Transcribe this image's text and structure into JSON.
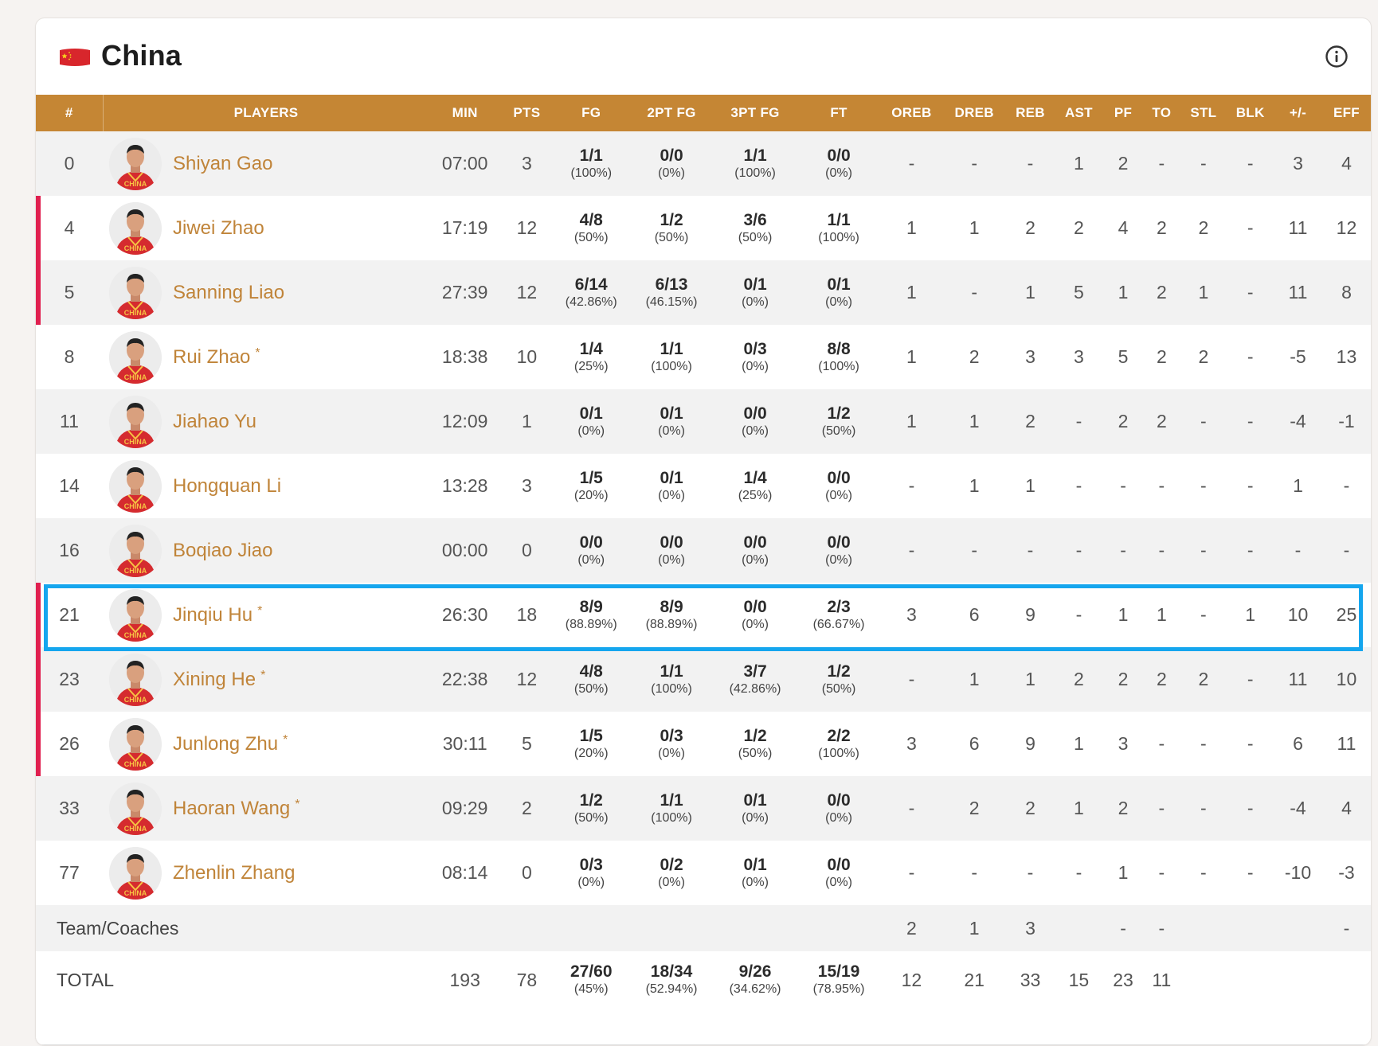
{
  "team": {
    "name": "China",
    "flag_icon": "china-flag-icon",
    "info_icon": "info-icon"
  },
  "columns": [
    "#",
    "PLAYERS",
    "MIN",
    "PTS",
    "FG",
    "2PT FG",
    "3PT FG",
    "FT",
    "OREB",
    "DREB",
    "REB",
    "AST",
    "PF",
    "TO",
    "STL",
    "BLK",
    "+/-",
    "EFF"
  ],
  "players": [
    {
      "num": "0",
      "name": "Shiyan Gao",
      "starter": false,
      "marked": false,
      "min": "07:00",
      "pts": "3",
      "fg": "1/1",
      "fg_pct": "(100%)",
      "fg2": "0/0",
      "fg2_pct": "(0%)",
      "fg3": "1/1",
      "fg3_pct": "(100%)",
      "ft": "0/0",
      "ft_pct": "(0%)",
      "oreb": "-",
      "dreb": "-",
      "reb": "-",
      "ast": "1",
      "pf": "2",
      "to": "-",
      "stl": "-",
      "blk": "-",
      "pm": "3",
      "eff": "4"
    },
    {
      "num": "4",
      "name": "Jiwei Zhao",
      "starter": false,
      "marked": true,
      "min": "17:19",
      "pts": "12",
      "fg": "4/8",
      "fg_pct": "(50%)",
      "fg2": "1/2",
      "fg2_pct": "(50%)",
      "fg3": "3/6",
      "fg3_pct": "(50%)",
      "ft": "1/1",
      "ft_pct": "(100%)",
      "oreb": "1",
      "dreb": "1",
      "reb": "2",
      "ast": "2",
      "pf": "4",
      "to": "2",
      "stl": "2",
      "blk": "-",
      "pm": "11",
      "eff": "12"
    },
    {
      "num": "5",
      "name": "Sanning Liao",
      "starter": false,
      "marked": true,
      "min": "27:39",
      "pts": "12",
      "fg": "6/14",
      "fg_pct": "(42.86%)",
      "fg2": "6/13",
      "fg2_pct": "(46.15%)",
      "fg3": "0/1",
      "fg3_pct": "(0%)",
      "ft": "0/1",
      "ft_pct": "(0%)",
      "oreb": "1",
      "dreb": "-",
      "reb": "1",
      "ast": "5",
      "pf": "1",
      "to": "2",
      "stl": "1",
      "blk": "-",
      "pm": "11",
      "eff": "8"
    },
    {
      "num": "8",
      "name": "Rui Zhao",
      "starter": true,
      "marked": false,
      "min": "18:38",
      "pts": "10",
      "fg": "1/4",
      "fg_pct": "(25%)",
      "fg2": "1/1",
      "fg2_pct": "(100%)",
      "fg3": "0/3",
      "fg3_pct": "(0%)",
      "ft": "8/8",
      "ft_pct": "(100%)",
      "oreb": "1",
      "dreb": "2",
      "reb": "3",
      "ast": "3",
      "pf": "5",
      "to": "2",
      "stl": "2",
      "blk": "-",
      "pm": "-5",
      "eff": "13"
    },
    {
      "num": "11",
      "name": "Jiahao Yu",
      "starter": false,
      "marked": false,
      "min": "12:09",
      "pts": "1",
      "fg": "0/1",
      "fg_pct": "(0%)",
      "fg2": "0/1",
      "fg2_pct": "(0%)",
      "fg3": "0/0",
      "fg3_pct": "(0%)",
      "ft": "1/2",
      "ft_pct": "(50%)",
      "oreb": "1",
      "dreb": "1",
      "reb": "2",
      "ast": "-",
      "pf": "2",
      "to": "2",
      "stl": "-",
      "blk": "-",
      "pm": "-4",
      "eff": "-1"
    },
    {
      "num": "14",
      "name": "Hongquan Li",
      "starter": false,
      "marked": false,
      "min": "13:28",
      "pts": "3",
      "fg": "1/5",
      "fg_pct": "(20%)",
      "fg2": "0/1",
      "fg2_pct": "(0%)",
      "fg3": "1/4",
      "fg3_pct": "(25%)",
      "ft": "0/0",
      "ft_pct": "(0%)",
      "oreb": "-",
      "dreb": "1",
      "reb": "1",
      "ast": "-",
      "pf": "-",
      "to": "-",
      "stl": "-",
      "blk": "-",
      "pm": "1",
      "eff": "-"
    },
    {
      "num": "16",
      "name": "Boqiao Jiao",
      "starter": false,
      "marked": false,
      "min": "00:00",
      "pts": "0",
      "fg": "0/0",
      "fg_pct": "(0%)",
      "fg2": "0/0",
      "fg2_pct": "(0%)",
      "fg3": "0/0",
      "fg3_pct": "(0%)",
      "ft": "0/0",
      "ft_pct": "(0%)",
      "oreb": "-",
      "dreb": "-",
      "reb": "-",
      "ast": "-",
      "pf": "-",
      "to": "-",
      "stl": "-",
      "blk": "-",
      "pm": "-",
      "eff": "-"
    },
    {
      "num": "21",
      "name": "Jinqiu Hu",
      "starter": true,
      "marked": true,
      "min": "26:30",
      "pts": "18",
      "fg": "8/9",
      "fg_pct": "(88.89%)",
      "fg2": "8/9",
      "fg2_pct": "(88.89%)",
      "fg3": "0/0",
      "fg3_pct": "(0%)",
      "ft": "2/3",
      "ft_pct": "(66.67%)",
      "oreb": "3",
      "dreb": "6",
      "reb": "9",
      "ast": "-",
      "pf": "1",
      "to": "1",
      "stl": "-",
      "blk": "1",
      "pm": "10",
      "eff": "25"
    },
    {
      "num": "23",
      "name": "Xining He",
      "starter": true,
      "marked": true,
      "min": "22:38",
      "pts": "12",
      "fg": "4/8",
      "fg_pct": "(50%)",
      "fg2": "1/1",
      "fg2_pct": "(100%)",
      "fg3": "3/7",
      "fg3_pct": "(42.86%)",
      "ft": "1/2",
      "ft_pct": "(50%)",
      "oreb": "-",
      "dreb": "1",
      "reb": "1",
      "ast": "2",
      "pf": "2",
      "to": "2",
      "stl": "2",
      "blk": "-",
      "pm": "11",
      "eff": "10"
    },
    {
      "num": "26",
      "name": "Junlong Zhu",
      "starter": true,
      "marked": true,
      "min": "30:11",
      "pts": "5",
      "fg": "1/5",
      "fg_pct": "(20%)",
      "fg2": "0/3",
      "fg2_pct": "(0%)",
      "fg3": "1/2",
      "fg3_pct": "(50%)",
      "ft": "2/2",
      "ft_pct": "(100%)",
      "oreb": "3",
      "dreb": "6",
      "reb": "9",
      "ast": "1",
      "pf": "3",
      "to": "-",
      "stl": "-",
      "blk": "-",
      "pm": "6",
      "eff": "11"
    },
    {
      "num": "33",
      "name": "Haoran Wang",
      "starter": true,
      "marked": false,
      "min": "09:29",
      "pts": "2",
      "fg": "1/2",
      "fg_pct": "(50%)",
      "fg2": "1/1",
      "fg2_pct": "(100%)",
      "fg3": "0/1",
      "fg3_pct": "(0%)",
      "ft": "0/0",
      "ft_pct": "(0%)",
      "oreb": "-",
      "dreb": "2",
      "reb": "2",
      "ast": "1",
      "pf": "2",
      "to": "-",
      "stl": "-",
      "blk": "-",
      "pm": "-4",
      "eff": "4"
    },
    {
      "num": "77",
      "name": "Zhenlin Zhang",
      "starter": false,
      "marked": false,
      "min": "08:14",
      "pts": "0",
      "fg": "0/3",
      "fg_pct": "(0%)",
      "fg2": "0/2",
      "fg2_pct": "(0%)",
      "fg3": "0/1",
      "fg3_pct": "(0%)",
      "ft": "0/0",
      "ft_pct": "(0%)",
      "oreb": "-",
      "dreb": "-",
      "reb": "-",
      "ast": "-",
      "pf": "1",
      "to": "-",
      "stl": "-",
      "blk": "-",
      "pm": "-10",
      "eff": "-3"
    }
  ],
  "team_row": {
    "label": "Team/Coaches",
    "oreb": "2",
    "dreb": "1",
    "reb": "3",
    "pf": "-",
    "to": "-",
    "eff": "-"
  },
  "total_row": {
    "label": "TOTAL",
    "min": "193",
    "pts": "78",
    "fg": "27/60",
    "fg_pct": "(45%)",
    "fg2": "18/34",
    "fg2_pct": "(52.94%)",
    "fg3": "9/26",
    "fg3_pct": "(34.62%)",
    "ft": "15/19",
    "ft_pct": "(78.95%)",
    "oreb": "12",
    "dreb": "21",
    "reb": "33",
    "ast": "15",
    "pf": "23",
    "to": "11"
  },
  "starter_marker": "*",
  "highlighted_player": "Jinqiu Hu",
  "colors": {
    "header_bg": "#c58634",
    "player_name": "#c08439",
    "row_marker": "#e01f4f",
    "highlight_border": "#15a6ee"
  }
}
